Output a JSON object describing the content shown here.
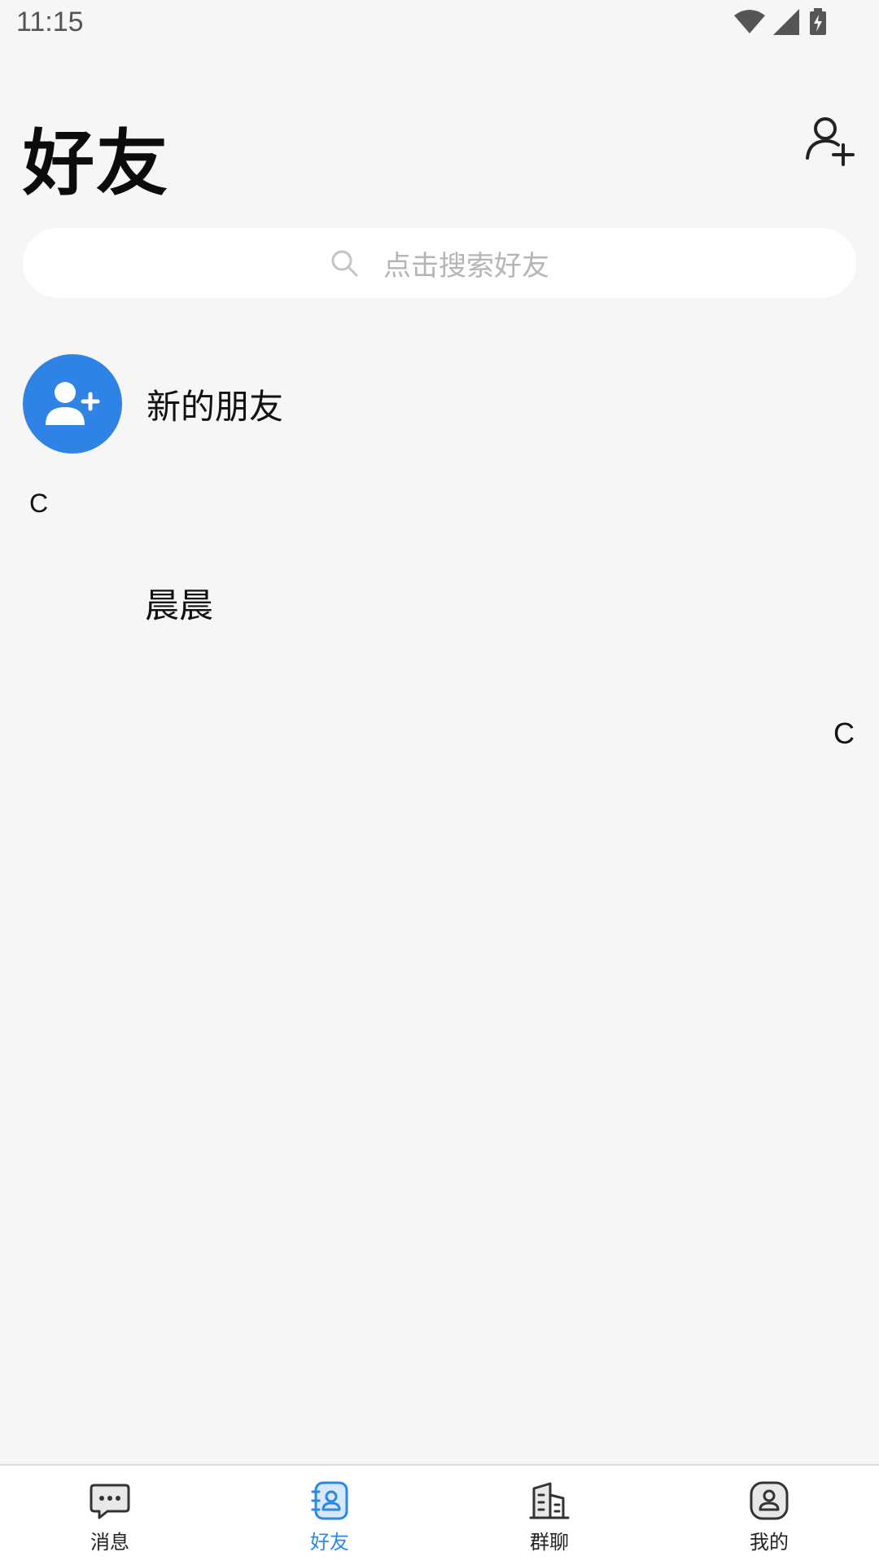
{
  "status_bar": {
    "time": "11:15"
  },
  "header": {
    "title": "好友"
  },
  "search": {
    "placeholder": "点击搜索好友"
  },
  "new_friends": {
    "label": "新的朋友"
  },
  "sections": [
    {
      "letter": "C",
      "friends": [
        {
          "name": "晨晨"
        }
      ]
    }
  ],
  "index_bar": {
    "letters": [
      "C"
    ]
  },
  "bottom_nav": {
    "active": 1,
    "items": [
      {
        "label": "消息",
        "icon": "chat-bubble-icon"
      },
      {
        "label": "好友",
        "icon": "contacts-icon"
      },
      {
        "label": "群聊",
        "icon": "group-building-icon"
      },
      {
        "label": "我的",
        "icon": "profile-icon"
      }
    ]
  },
  "colors": {
    "accent": "#2b88e6",
    "avatar_bg": "#2f83e4",
    "background": "#f6f6f7"
  }
}
